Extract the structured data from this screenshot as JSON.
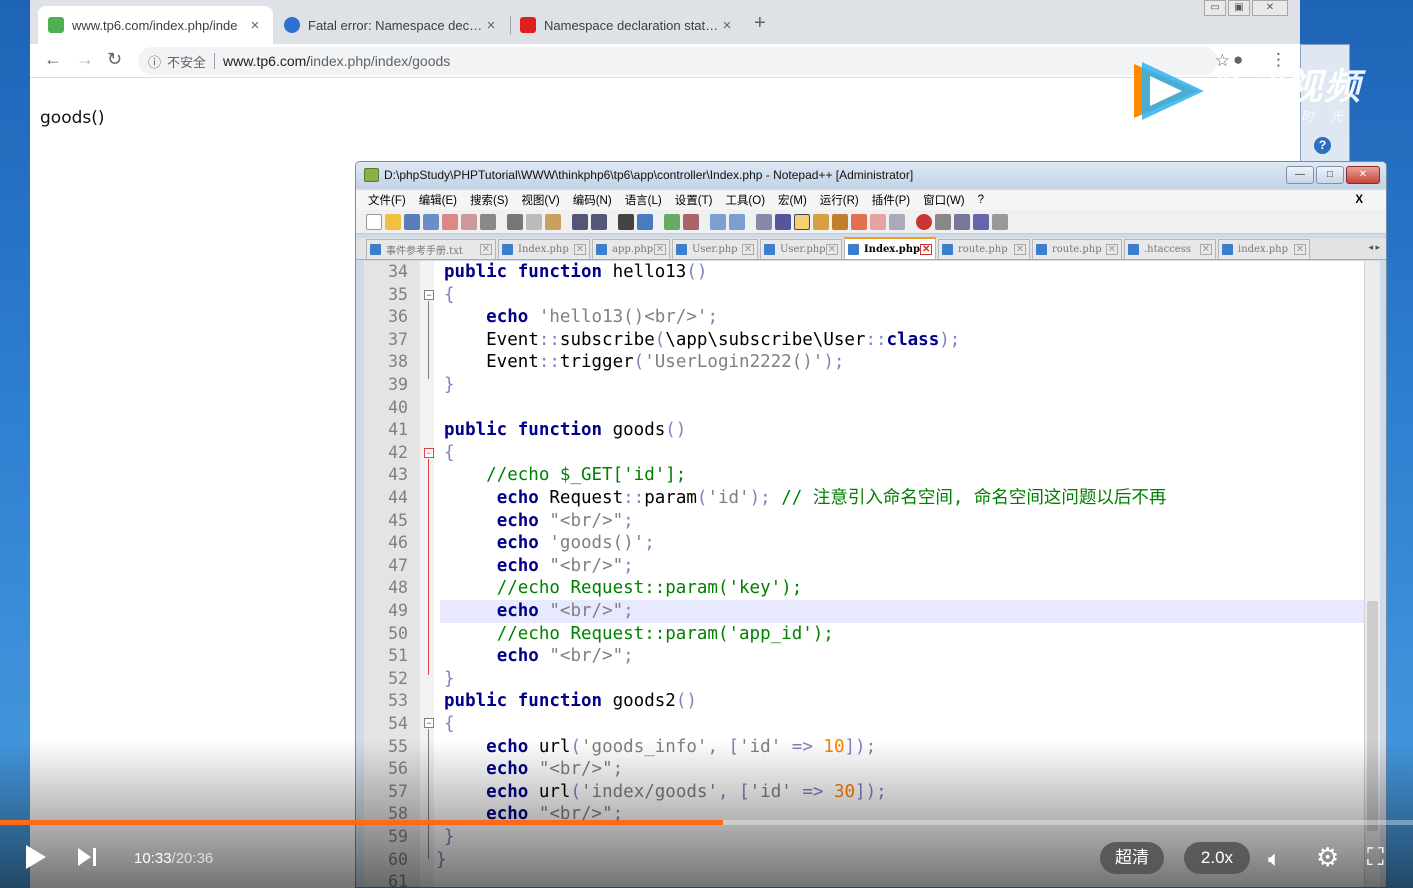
{
  "browser": {
    "tabs": [
      {
        "title": "www.tp6.com/index.php/inde",
        "active": true
      },
      {
        "title": "Fatal error: Namespace declar",
        "active": false
      },
      {
        "title": "Namespace declaration staten",
        "active": false
      }
    ],
    "new_tab": "+",
    "close_glyph": "×",
    "security_label": "不安全",
    "url_host": "www.tp6.com/",
    "url_path": "index.php/index/goods",
    "page_text": "goods()"
  },
  "watermark": {
    "brand": "腾讯视频",
    "slogan": "不负好时光"
  },
  "npp": {
    "title": "D:\\phpStudy\\PHPTutorial\\WWW\\thinkphp6\\tp6\\app\\controller\\Index.php - Notepad++ [Administrator]",
    "menu": [
      "文件(F)",
      "编辑(E)",
      "搜索(S)",
      "视图(V)",
      "编码(N)",
      "语言(L)",
      "设置(T)",
      "工具(O)",
      "宏(M)",
      "运行(R)",
      "插件(P)",
      "窗口(W)",
      "?"
    ],
    "menu_close": "X",
    "file_tabs": [
      {
        "name": "事件参考手册.txt",
        "active": false
      },
      {
        "name": "Index.php",
        "active": false
      },
      {
        "name": "app.php",
        "active": false
      },
      {
        "name": "User.php",
        "active": false
      },
      {
        "name": "User.php",
        "active": false
      },
      {
        "name": "Index.php",
        "active": true
      },
      {
        "name": "route.php",
        "active": false
      },
      {
        "name": "route.php",
        "active": false
      },
      {
        "name": ".htaccess",
        "active": false
      },
      {
        "name": "index.php",
        "active": false
      }
    ],
    "line_numbers": [
      "34",
      "35",
      "36",
      "37",
      "38",
      "39",
      "40",
      "41",
      "42",
      "43",
      "44",
      "45",
      "46",
      "47",
      "48",
      "49",
      "50",
      "51",
      "52",
      "53",
      "54",
      "55",
      "56",
      "57",
      "58",
      "59",
      "60",
      "61"
    ]
  },
  "player": {
    "current_time": "10:33",
    "duration": "/20:36",
    "progress": 0.512,
    "quality": "超清",
    "speed": "2.0x",
    "accent": "#ff6a1a"
  }
}
